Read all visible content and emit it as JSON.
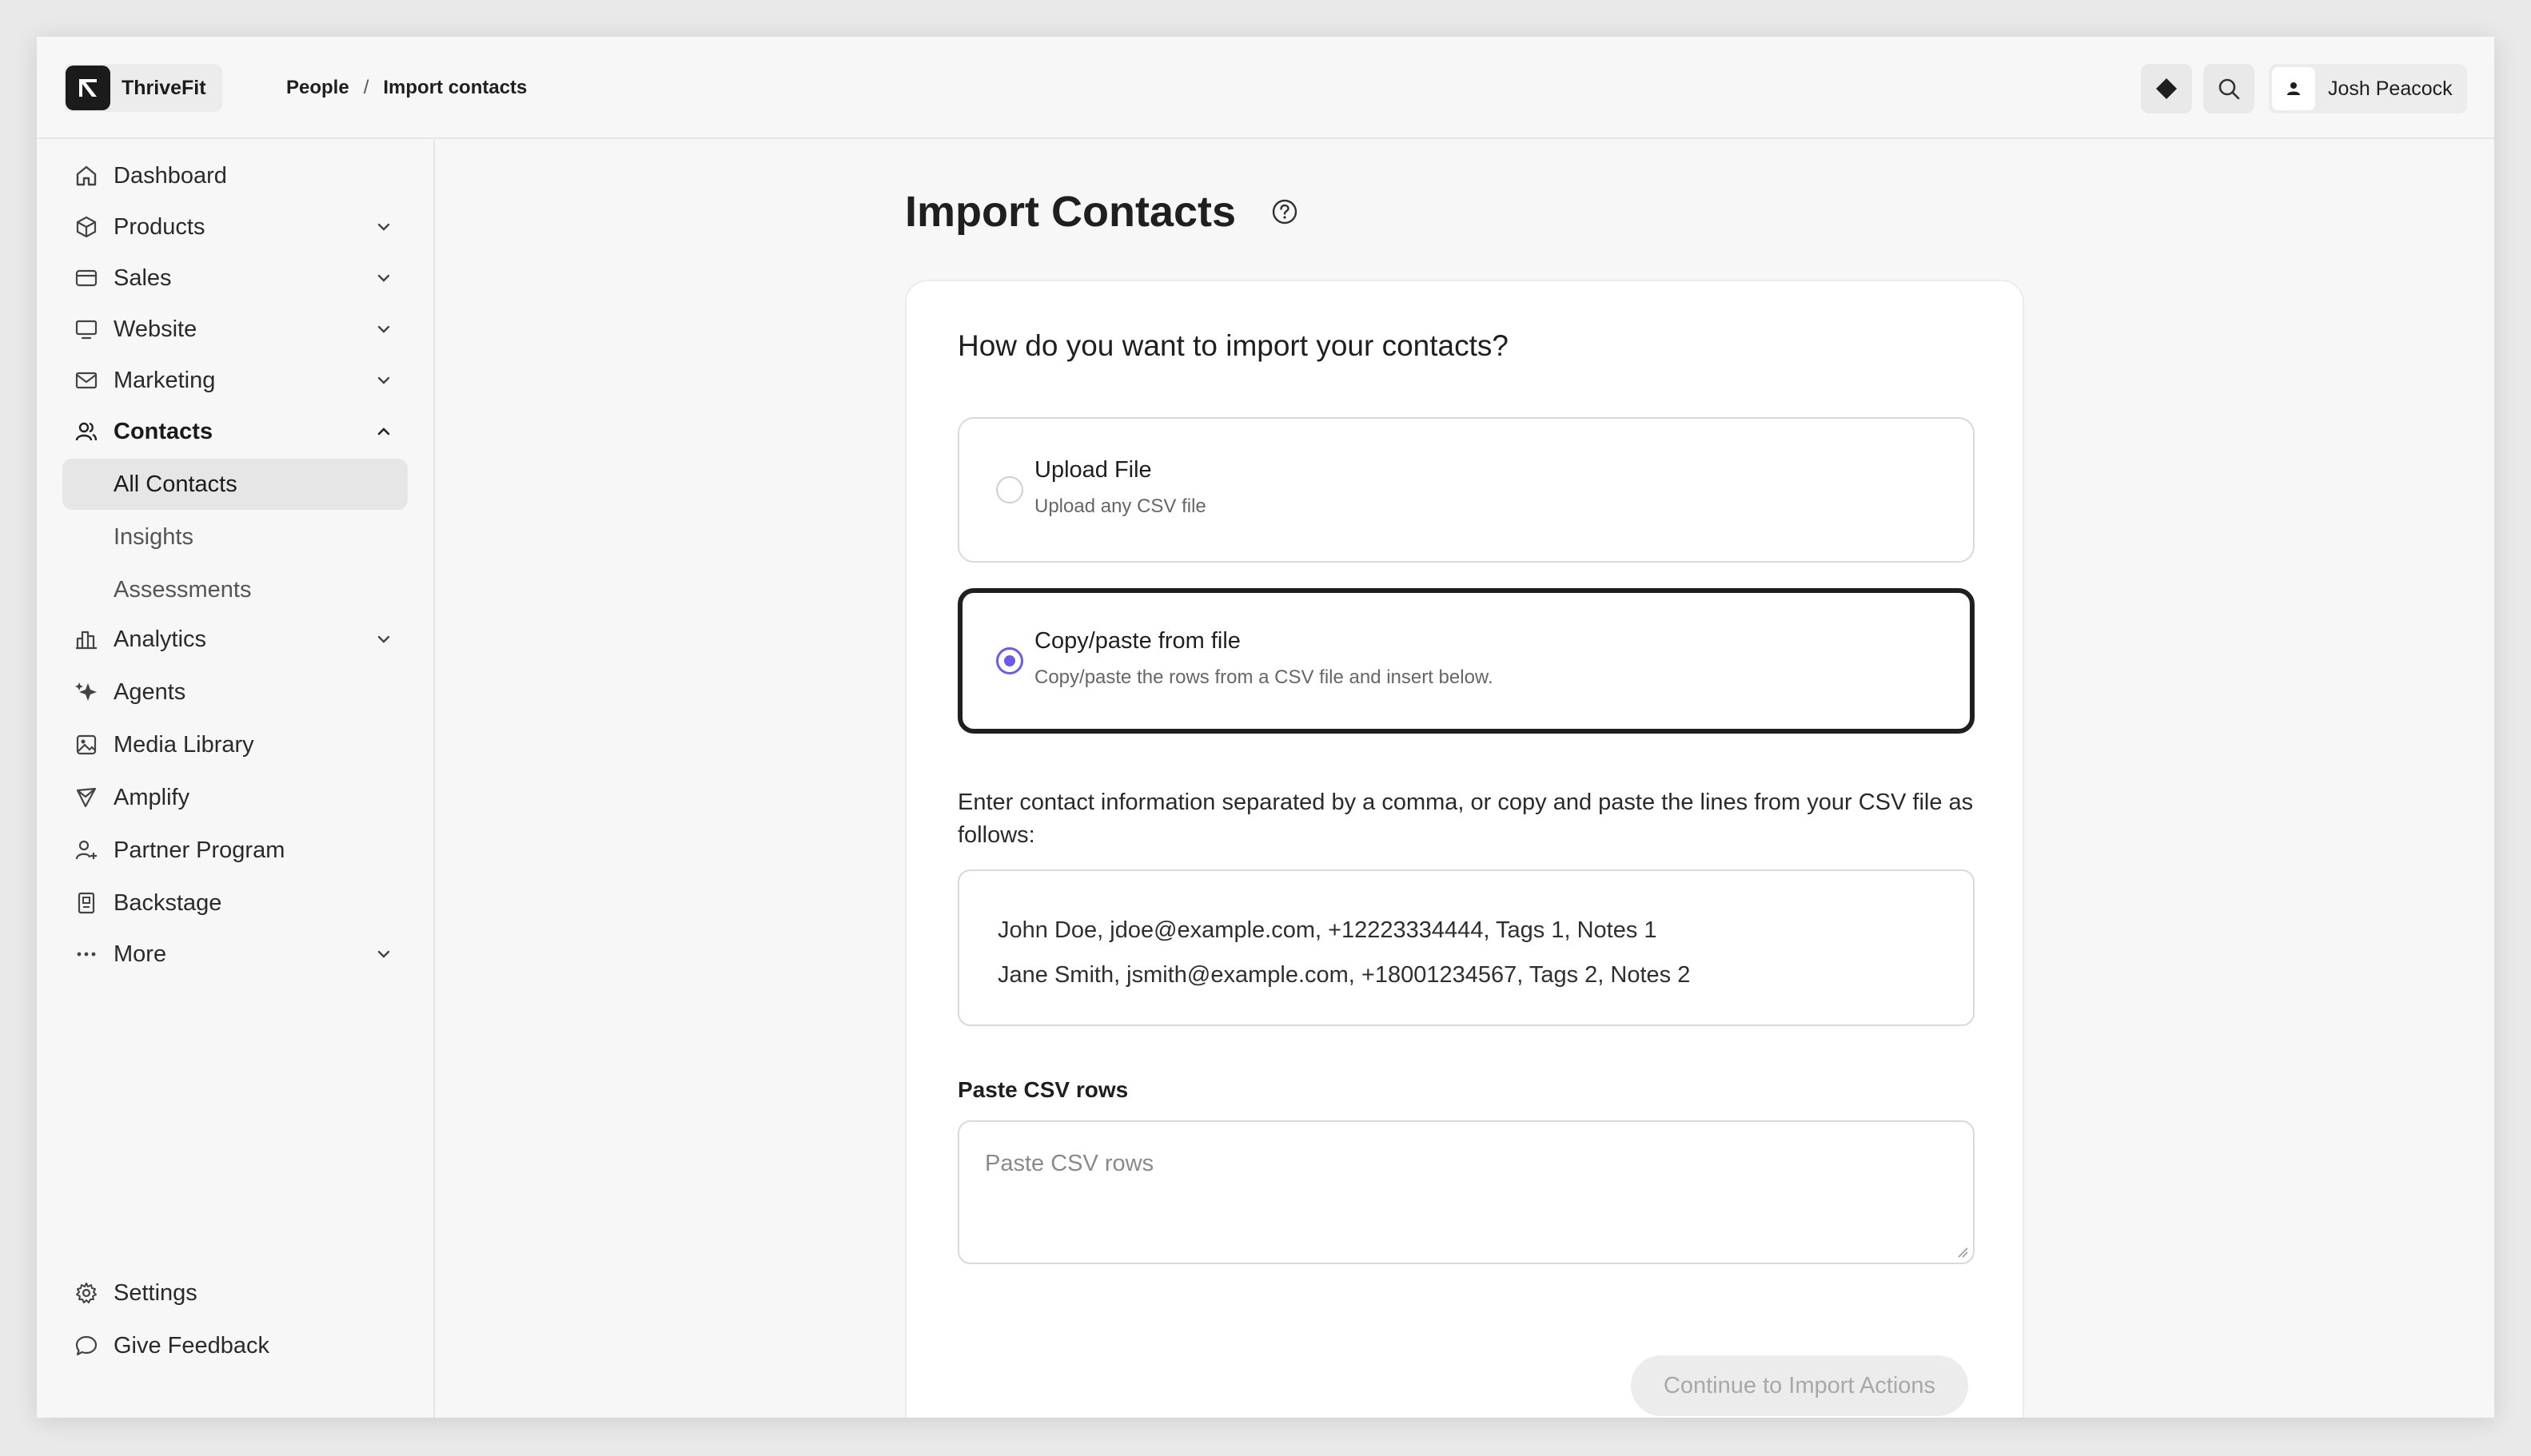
{
  "app": {
    "name": "ThriveFit"
  },
  "breadcrumb": {
    "items": [
      "People",
      "Import contacts"
    ],
    "separator": "/"
  },
  "header": {
    "user_name": "Josh Peacock",
    "icons": [
      "diamond-icon",
      "search-icon",
      "user-icon"
    ]
  },
  "sidebar": {
    "items": [
      {
        "label": "Dashboard",
        "icon": "home-icon",
        "has_chevron": false
      },
      {
        "label": "Products",
        "icon": "box-icon",
        "has_chevron": true
      },
      {
        "label": "Sales",
        "icon": "credit-card-icon",
        "has_chevron": true
      },
      {
        "label": "Website",
        "icon": "monitor-icon",
        "has_chevron": true
      },
      {
        "label": "Marketing",
        "icon": "mail-icon",
        "has_chevron": true
      },
      {
        "label": "Contacts",
        "icon": "users-icon",
        "has_chevron": true,
        "expanded": true
      },
      {
        "label": "Analytics",
        "icon": "bar-chart-icon",
        "has_chevron": true
      },
      {
        "label": "Agents",
        "icon": "sparkle-icon",
        "has_chevron": false
      },
      {
        "label": "Media Library",
        "icon": "image-icon",
        "has_chevron": false
      },
      {
        "label": "Amplify",
        "icon": "megaphone-icon",
        "has_chevron": false
      },
      {
        "label": "Partner Program",
        "icon": "user-plus-icon",
        "has_chevron": false
      },
      {
        "label": "Backstage",
        "icon": "id-badge-icon",
        "has_chevron": false
      },
      {
        "label": "More",
        "icon": "dots-icon",
        "has_chevron": true
      }
    ],
    "contacts_sub": [
      {
        "label": "All Contacts",
        "active": true
      },
      {
        "label": "Insights",
        "active": false
      },
      {
        "label": "Assessments",
        "active": false
      }
    ],
    "footer": [
      {
        "label": "Settings",
        "icon": "gear-icon"
      },
      {
        "label": "Give Feedback",
        "icon": "chat-bubble-icon"
      }
    ]
  },
  "main": {
    "title": "Import Contacts",
    "question": "How do you want to import your contacts?",
    "options": [
      {
        "title": "Upload File",
        "description": "Upload any CSV file",
        "selected": false
      },
      {
        "title": "Copy/paste from file",
        "description": "Copy/paste the rows from a CSV file and insert below.",
        "selected": true
      }
    ],
    "instructions": "Enter contact information separated by a comma, or copy and paste the lines from your CSV file as follows:",
    "example_lines": [
      "John Doe, jdoe@example.com, +12223334444, Tags 1, Notes 1",
      "Jane Smith, jsmith@example.com, +18001234567, Tags 2, Notes 2"
    ],
    "paste_label": "Paste CSV rows",
    "paste_placeholder": "Paste CSV rows",
    "paste_value": "",
    "continue_label": "Continue to Import Actions"
  },
  "colors": {
    "accent": "#6b5ce7",
    "background": "#f7f7f7",
    "card": "#ffffff",
    "disabled_text": "#a8a8a8"
  }
}
